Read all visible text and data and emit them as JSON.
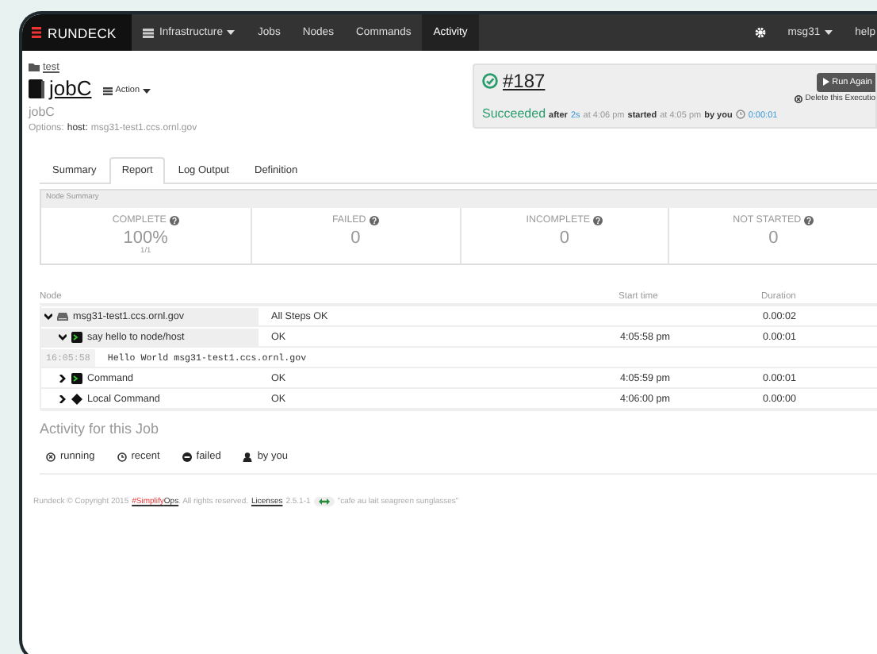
{
  "navbar": {
    "brand": "RUNDECK",
    "items": [
      {
        "label": "Infrastructure",
        "dropdown": true,
        "selected": false
      },
      {
        "label": "Jobs",
        "dropdown": false,
        "selected": false
      },
      {
        "label": "Nodes",
        "dropdown": false,
        "selected": false
      },
      {
        "label": "Commands",
        "dropdown": false,
        "selected": false
      },
      {
        "label": "Activity",
        "dropdown": false,
        "selected": true
      }
    ],
    "user": "msg31",
    "help": "help"
  },
  "job": {
    "project": "test",
    "name": "jobC",
    "action": "Action",
    "description": "jobC",
    "options_label": "Options:",
    "option_key": "host:",
    "option_value": "msg31-test1.ccs.ornl.gov"
  },
  "execution": {
    "id": "#187",
    "status": "Succeeded",
    "after": "after",
    "elapsed": "2s",
    "ended_at": "at 4:06 pm",
    "started": "started",
    "started_at": "at 4:05 pm",
    "by": "by you",
    "duration": "0:00:01",
    "run_again": "Run Again",
    "delete": "Delete this Executio"
  },
  "tabs": [
    {
      "label": "Summary",
      "selected": false
    },
    {
      "label": "Report",
      "selected": true
    },
    {
      "label": "Log Output",
      "selected": false
    },
    {
      "label": "Definition",
      "selected": false
    }
  ],
  "node_summary": {
    "title": "Node Summary",
    "stats": [
      {
        "label": "COMPLETE",
        "value": "100%",
        "sub": "1/1"
      },
      {
        "label": "FAILED",
        "value": "0"
      },
      {
        "label": "INCOMPLETE",
        "value": "0"
      },
      {
        "label": "NOT STARTED",
        "value": "0"
      }
    ]
  },
  "node_table": {
    "node_header": "Node",
    "start_header": "Start time",
    "duration_header": "Duration",
    "rows": [
      {
        "kind": "node",
        "label": "msg31-test1.ccs.ornl.gov",
        "status": "All Steps OK",
        "duration": "0.00:02",
        "expanded": true,
        "children": [
          {
            "kind": "command",
            "label": "say hello to node/host",
            "status": "OK",
            "start": "4:05:58 pm",
            "duration": "0.00:01",
            "expanded": true,
            "log": [
              {
                "time": "16:05:58",
                "text": "Hello World msg31-test1.ccs.ornl.gov"
              }
            ]
          },
          {
            "kind": "command",
            "label": "Command",
            "status": "OK",
            "start": "4:05:59 pm",
            "duration": "0.00:01",
            "expanded": false
          },
          {
            "kind": "script",
            "label": "Local Command",
            "status": "OK",
            "start": "4:06:00 pm",
            "duration": "0.00:00",
            "expanded": false
          }
        ]
      }
    ]
  },
  "activity": {
    "title": "Activity for this Job",
    "filters": [
      {
        "kind": "running",
        "label": "running"
      },
      {
        "kind": "recent",
        "label": "recent"
      },
      {
        "kind": "failed",
        "label": "failed"
      },
      {
        "kind": "user",
        "label": "by you"
      }
    ]
  },
  "footer": {
    "copyright": "Rundeck © Copyright 2015",
    "brand_red": "#Simplify",
    "brand_rest": "Ops",
    "rights": ". All rights reserved.",
    "licenses": "Licenses",
    "version": "2.5.1-1",
    "release": "\"cafe au lait seagreen sunglasses\""
  }
}
